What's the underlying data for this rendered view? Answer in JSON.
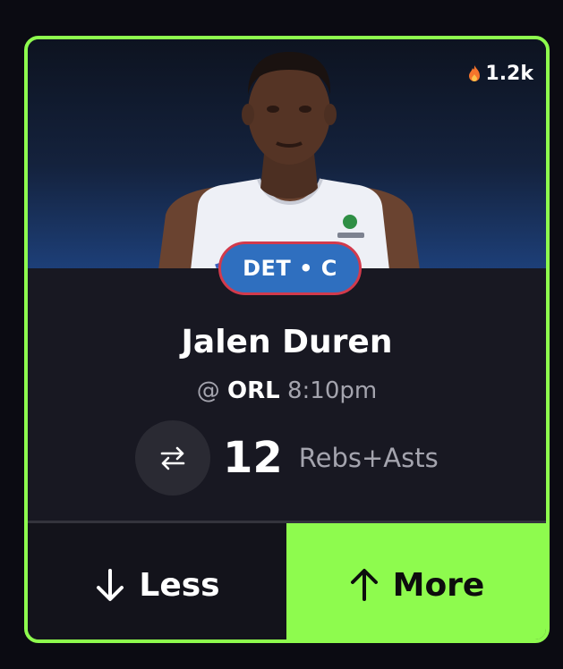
{
  "hype": {
    "count": "1.2k",
    "icon": "flame-icon"
  },
  "player": {
    "team_position": "DET • C",
    "name": "Jalen Duren",
    "matchup_prefix": "@",
    "opponent": "ORL",
    "game_time": "8:10pm",
    "photo_icon": "player-headshot"
  },
  "stat": {
    "value": "12",
    "label": "Rebs+Asts",
    "swap_icon": "swap-arrows-icon"
  },
  "buttons": {
    "less_label": "Less",
    "more_label": "More"
  },
  "colors": {
    "accent": "#8efb4e",
    "card_bg": "#181822",
    "page_bg": "#0b0b12",
    "badge_bg": "#2f6fbf",
    "badge_border": "#d23a4c",
    "muted_text": "#a4a4ae"
  }
}
